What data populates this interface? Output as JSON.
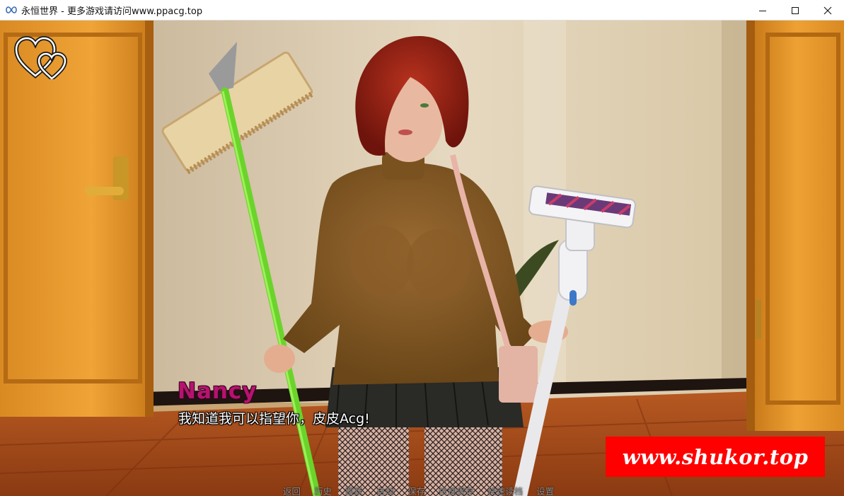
{
  "window": {
    "title": "永恒世界 - 更多游戏请访问www.ppacg.top",
    "icons": [
      "infinity-icon",
      "minimize-icon",
      "maximize-icon",
      "close-icon"
    ]
  },
  "dialogue": {
    "speaker": "Nancy",
    "text": "我知道我可以指望你，皮皮Acg!",
    "speaker_color": "#b4146e"
  },
  "quick_menu": {
    "items": [
      "返回",
      "历史",
      "跳跃",
      "自动",
      "保存",
      "快速保存",
      "快速读档",
      "设置"
    ]
  },
  "watermark": {
    "text": "www.shukor.top",
    "color": "#ff0000"
  },
  "hud": {
    "hearts_icon": "hearts-icon"
  }
}
